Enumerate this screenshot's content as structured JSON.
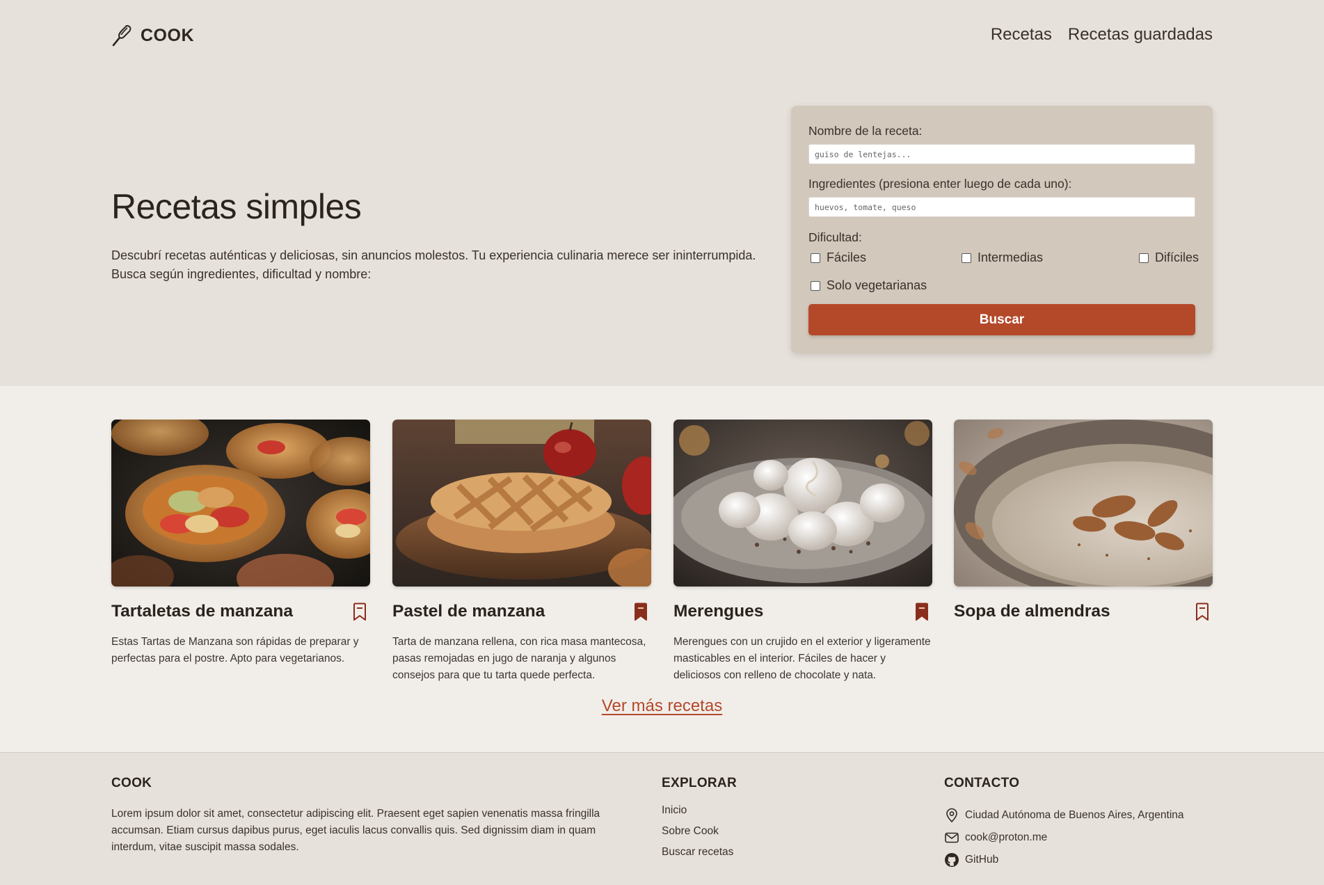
{
  "app": {
    "logo_text": "COOK"
  },
  "nav": {
    "items": [
      {
        "label": "Recetas"
      },
      {
        "label": "Recetas guardadas"
      }
    ]
  },
  "hero": {
    "title": "Recetas simples",
    "description": "Descubrí recetas auténticas y deliciosas, sin anuncios molestos. Tu experiencia culinaria merece ser ininterrumpida. Busca según ingredientes, dificultad y nombre:"
  },
  "search": {
    "name_label": "Nombre de la receta:",
    "name_placeholder": "guiso de lentejas...",
    "name_value": "",
    "ingredients_label": "Ingredientes (presiona enter luego de cada uno):",
    "ingredients_placeholder": "huevos, tomate, queso",
    "ingredients_value": "",
    "difficulty_label": "Dificultad:",
    "difficulty_options": [
      {
        "label": "Fáciles",
        "checked": false
      },
      {
        "label": "Intermedias",
        "checked": false
      },
      {
        "label": "Difíciles",
        "checked": false
      }
    ],
    "vegetarian_label": "Solo vegetarianas",
    "vegetarian_checked": false,
    "submit_label": "Buscar"
  },
  "recipes": {
    "items": [
      {
        "title": "Tartaletas de manzana",
        "description": "Estas Tartas de Manzana son rápidas de preparar y perfectas para el postre. Apto para vegetarianos.",
        "saved": false
      },
      {
        "title": "Pastel de manzana",
        "description": "Tarta de manzana rellena, con rica masa mantecosa, pasas remojadas en jugo de naranja y algunos consejos para que tu tarta quede perfecta.",
        "saved": true
      },
      {
        "title": "Merengues",
        "description": "Merengues con un crujido en el exterior y ligeramente masticables en el interior. Fáciles de hacer y deliciosos con relleno de chocolate y nata.",
        "saved": true
      },
      {
        "title": "Sopa de almendras",
        "description": "",
        "saved": false
      }
    ],
    "more_label": "Ver más recetas"
  },
  "footer": {
    "about_title": "COOK",
    "about_text": "Lorem ipsum dolor sit amet, consectetur adipiscing elit. Praesent eget sapien venenatis massa fringilla accumsan. Etiam cursus dapibus purus, eget iaculis lacus convallis quis. Sed dignissim diam in quam interdum, vitae suscipit massa sodales.",
    "explore_title": "EXPLORAR",
    "explore_links": [
      {
        "label": "Inicio"
      },
      {
        "label": "Sobre Cook"
      },
      {
        "label": "Buscar recetas"
      }
    ],
    "contact_title": "CONTACTO",
    "contact_items": [
      {
        "icon": "location-pin-icon",
        "label": "Ciudad Autónoma de Buenos Aires, Argentina"
      },
      {
        "icon": "mail-icon",
        "label": "cook@proton.me"
      },
      {
        "icon": "github-icon",
        "label": "GitHub"
      }
    ]
  },
  "colors": {
    "accent": "#b4492a",
    "bookmark_filled": "#8a2e1c",
    "page_bg": "#e7e1db",
    "section_bg": "#f1eeea",
    "search_card_bg": "#d2c8bc"
  }
}
